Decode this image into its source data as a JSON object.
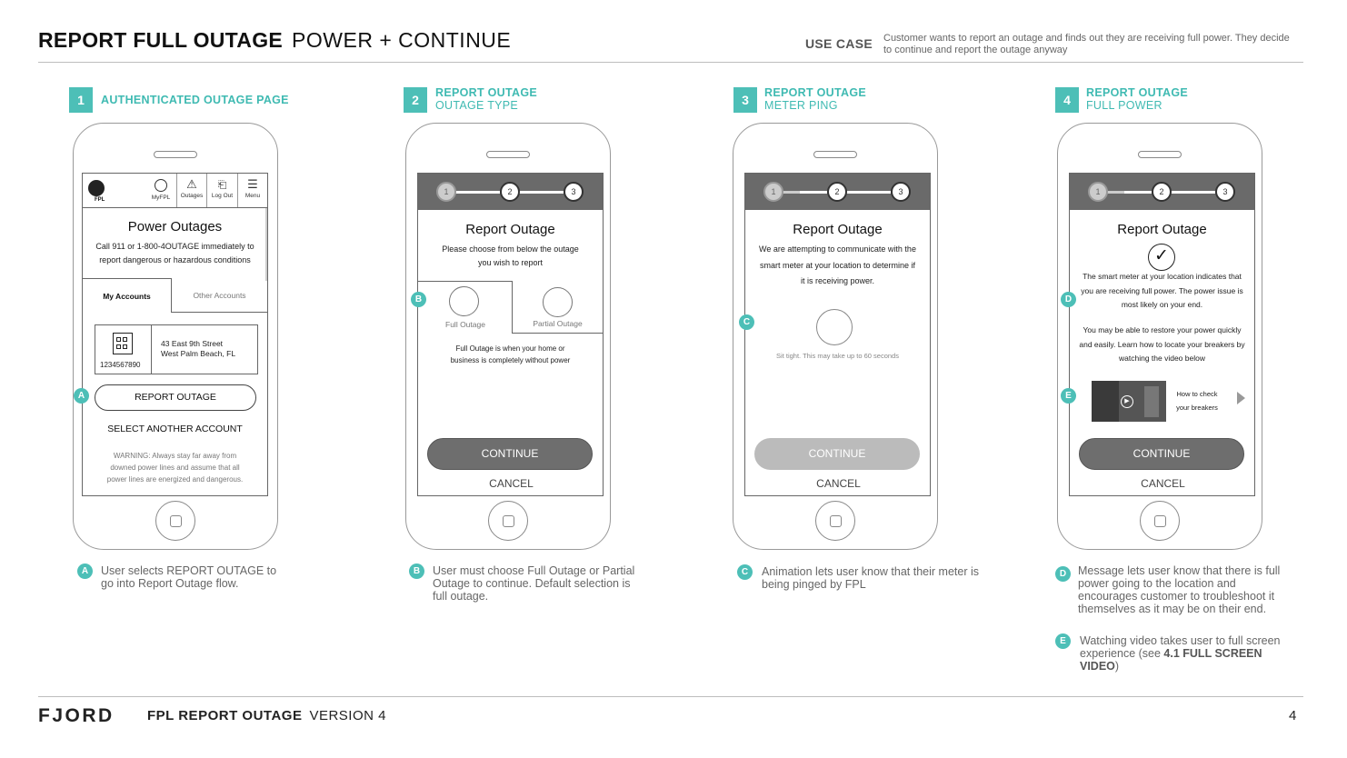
{
  "header": {
    "title": "REPORT FULL OUTAGE",
    "subtitle": "POWER + CONTINUE",
    "use_case_label": "USE CASE",
    "use_case_text": "Customer wants to report an outage and finds out they are receiving full power.  They decide to continue and report the outage anyway"
  },
  "steps": [
    {
      "num": "1",
      "title": "AUTHENTICATED OUTAGE PAGE"
    },
    {
      "num": "2",
      "title": "REPORT OUTAGE",
      "subtitle": "OUTAGE TYPE"
    },
    {
      "num": "3",
      "title": "REPORT OUTAGE",
      "subtitle": "METER PING"
    },
    {
      "num": "4",
      "title": "REPORT OUTAGE",
      "subtitle": "FULL POWER"
    }
  ],
  "screen1": {
    "logo": "FPL",
    "nav": [
      "MyFPL",
      "Outages",
      "Log Out",
      "Menu"
    ],
    "title": "Power Outages",
    "body": "Call 911 or 1-800-4OUTAGE immediately to report dangerous or hazardous conditions",
    "tabs": [
      "My Accounts",
      "Other Accounts"
    ],
    "address_line1": "43 East 9th Street",
    "address_line2": "West Palm Beach, FL",
    "account_number": "1234567890",
    "report_button": "REPORT OUTAGE",
    "select_another": "SELECT ANOTHER ACCOUNT",
    "warning": "WARNING: Always stay far away from downed power lines and assume that all power lines are energized and dangerous."
  },
  "progress": [
    "1",
    "2",
    "3"
  ],
  "screen2": {
    "title": "Report Outage",
    "body": "Please choose from below the outage you wish to report",
    "option_full": "Full Outage",
    "option_partial": "Partial Outage",
    "desc": "Full Outage is when your home or business is completely without power",
    "continue": "CONTINUE",
    "cancel": "CANCEL"
  },
  "screen3": {
    "title": "Report Outage",
    "body": "We are attempting to communicate with the smart meter at your location to determine if it is receiving power.",
    "wait": "Sit tight. This may take up to 60 seconds",
    "continue": "CONTINUE",
    "cancel": "CANCEL"
  },
  "screen4": {
    "title": "Report Outage",
    "message": "The smart meter at your location indicates that you are receiving full power.  The power issue is most likely on your end.",
    "restore": "You may be able to restore your power quickly and easily. Learn how to locate your breakers by watching the video below",
    "video_line1": "How to check",
    "video_line2": "your breakers",
    "continue": "CONTINUE",
    "cancel": "CANCEL"
  },
  "markers": {
    "A": "A",
    "B": "B",
    "C": "C",
    "D": "D",
    "E": "E"
  },
  "notes": {
    "A": "User selects REPORT OUTAGE to go into Report Outage flow.",
    "B": "User must choose Full Outage or Partial Outage to continue.  Default selection is full outage.",
    "C": "Animation lets user know that their meter is being pinged by FPL",
    "D": "Message lets user know that there is full power going to the location and encourages customer to troubleshoot it themselves as it may be on their end.",
    "E_prefix": "Watching video takes user to full screen experience (see ",
    "E_bold": "4.1 FULL SCREEN VIDEO",
    "E_suffix": ")"
  },
  "footer": {
    "logo": "FJORD",
    "title": "FPL REPORT OUTAGE",
    "version": "VERSION 4",
    "page": "4"
  },
  "colors": {
    "accent": "#4dbfb7",
    "progress_bar": "#6a6a6a",
    "button_dark": "#6e6e6e",
    "button_disabled": "#bbbbbb"
  }
}
